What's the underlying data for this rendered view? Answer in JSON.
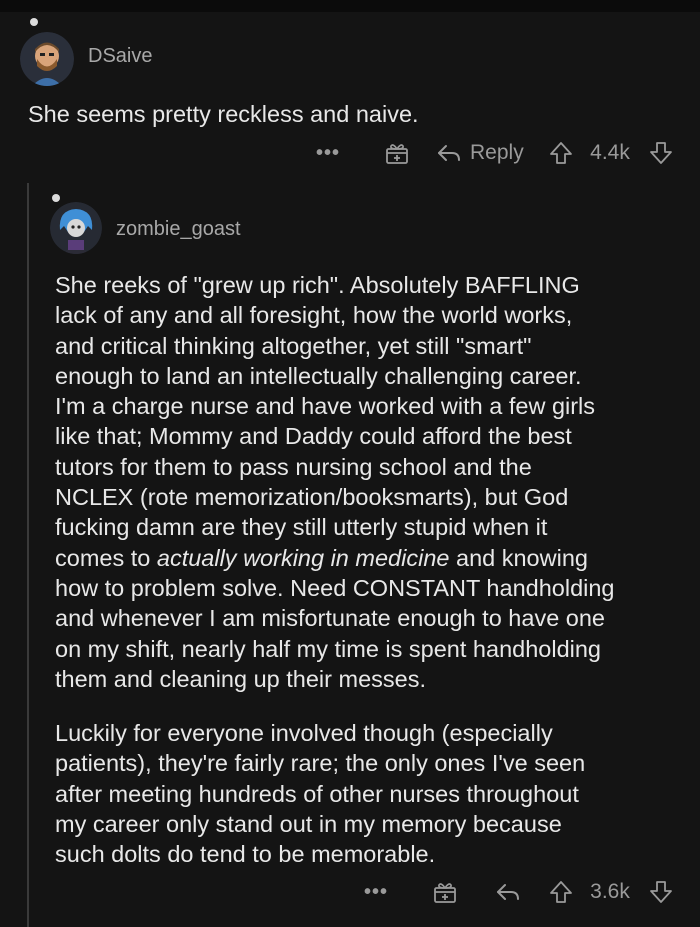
{
  "comments": [
    {
      "username": "DSaive",
      "body": "She seems pretty reckless and naive.",
      "actions": {
        "more": "•••",
        "award_icon": "gift-icon",
        "reply_label": "Reply",
        "upvote_icon": "arrow-up-icon",
        "score": "4.4k",
        "downvote_icon": "arrow-down-icon"
      }
    },
    {
      "username": "zombie_goast",
      "body_p1_part1": "She reeks of \"grew up rich\". Absolutely BAFFLING\nlack of any and all foresight, how the world works,\nand critical thinking altogether, yet still \"smart\"\nenough to land an intellectually challenging career.\nI'm a charge nurse and have worked with a few girls\nlike that; Mommy and Daddy could afford the best\ntutors for them to pass nursing school and the\nNCLEX (rote memorization/booksmarts), but God\nfucking damn are they still utterly stupid when it\ncomes to ",
      "body_p1_italic": "actually working in medicine",
      "body_p1_part2": " and knowing\nhow to problem solve. Need CONSTANT handholding\nand whenever I am misfortunate enough to have one\non my shift, nearly half my time is spent handholding\nthem and cleaning up their messes.",
      "body_p2": "Luckily for everyone involved though (especially\npatients), they're fairly rare; the only ones I've seen\nafter meeting hundreds of other nurses throughout\nmy career only stand out in my memory because\nsuch dolts do tend to be memorable.",
      "actions": {
        "more": "•••",
        "award_icon": "gift-icon",
        "reply_icon": "reply-arrow-icon",
        "upvote_icon": "arrow-up-icon",
        "score": "3.6k",
        "downvote_icon": "arrow-down-icon"
      }
    }
  ],
  "colors": {
    "background": "#141414",
    "text": "#e8e8e8",
    "muted": "#9a9a9a",
    "thread_line": "#3a3a3a"
  }
}
